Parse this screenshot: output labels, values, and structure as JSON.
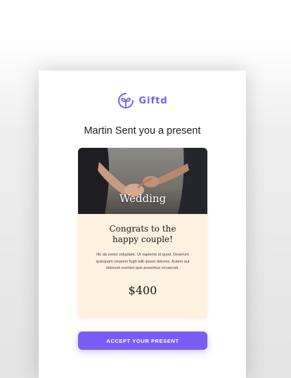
{
  "brand": {
    "name": "Giftd",
    "accent": "#7a5cf5"
  },
  "heading": "Martin Sent you a present",
  "gift_card": {
    "image_label": "Wedding",
    "title_line1": "Congrats to the",
    "title_line2": "happy couple!",
    "message": "Illo ab nemo voluptate. Ut sapiente id quod. Deserunt quisquam corporis fugit odit ipsam dolores. Autem aut laborum eveniet quis possimus occaecati.",
    "price": "$400",
    "background": "#fdf1df"
  },
  "cta": {
    "label": "ACCEPT YOUR PRESENT"
  }
}
